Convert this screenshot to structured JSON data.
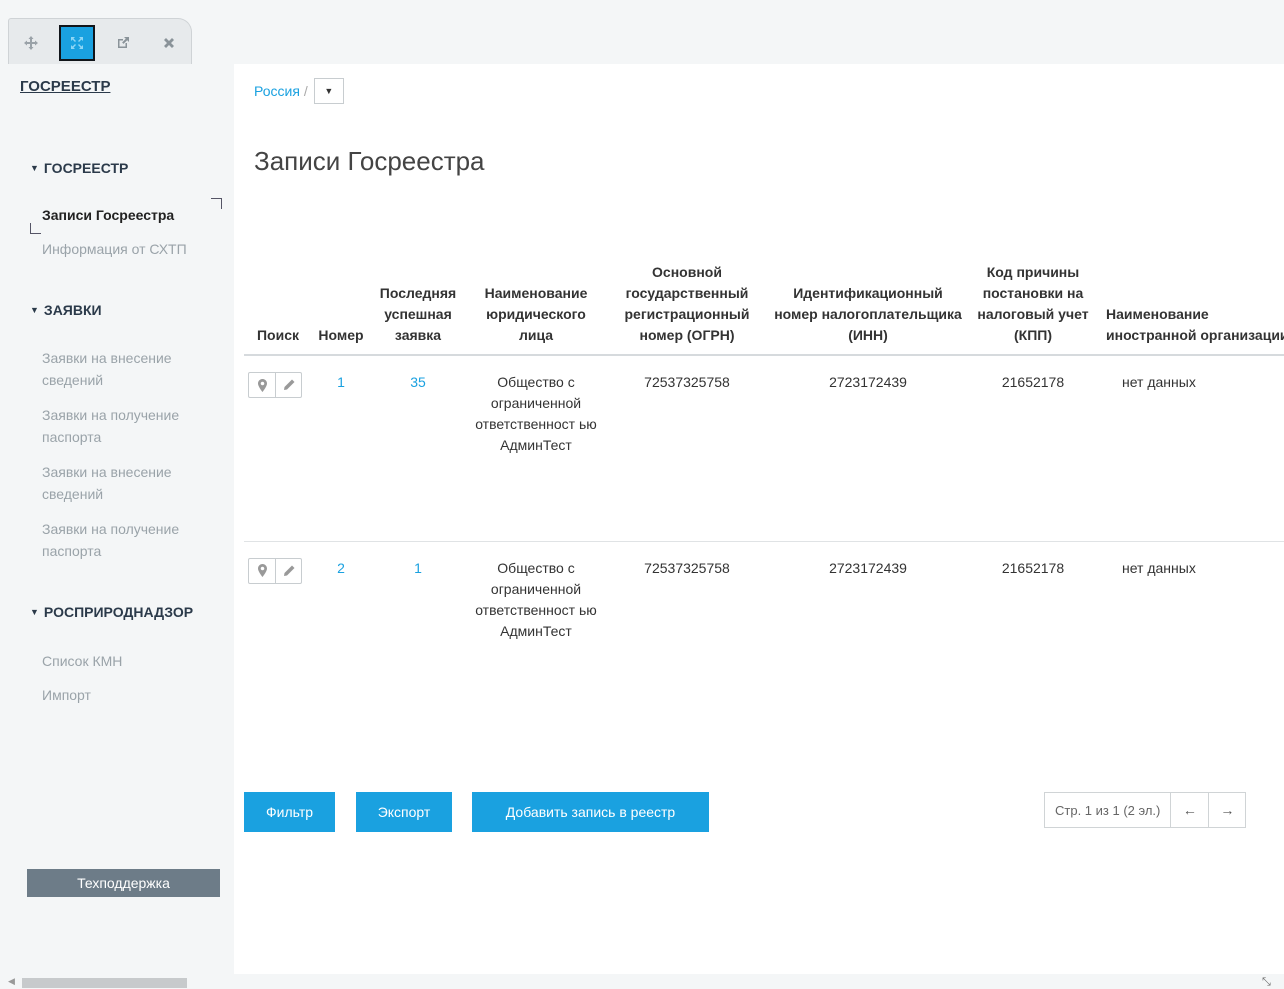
{
  "toolbar": {
    "buttons": [
      {
        "icon": "move-icon"
      },
      {
        "icon": "expand-icon",
        "active": true
      },
      {
        "icon": "external-link-icon"
      },
      {
        "icon": "close-icon"
      }
    ]
  },
  "sidebar": {
    "brand": "ГОСРЕЕСТР",
    "sections": [
      {
        "title": "ГОСРЕЕСТР",
        "items": [
          "Записи Госреестра",
          "Информация от СХТП"
        ]
      },
      {
        "title": "ЗАЯВКИ",
        "items": [
          "Заявки на внесение сведений",
          "Заявки на получение паспорта",
          "Заявки на внесение сведений",
          "Заявки на получение паспорта"
        ]
      },
      {
        "title": "РОСПРИРОДНАДЗОР",
        "items": [
          "Список КМН",
          "Импорт"
        ]
      }
    ],
    "support_label": "Техподдержка"
  },
  "breadcrumb": {
    "root": "Россия",
    "separator": "/"
  },
  "page": {
    "title": "Записи Госреестра"
  },
  "table": {
    "columns": [
      "Поиск",
      "Номер",
      "Последняя успешная заявка",
      "Наименование юридического лица",
      "Основной государственный регистрационный номер (ОГРН)",
      "Идентификационный номер налогоплательщика (ИНН)",
      "Код причины постановки на налоговый учет (КПП)",
      "Наименование иностранной организации"
    ],
    "rows": [
      {
        "number": "1",
        "last_request": "35",
        "name": "Общество с ограниченной ответственност ью АдминТест",
        "ogrn": "72537325758",
        "inn": "2723172439",
        "kpp": "21652178",
        "foreign_name": "нет данных"
      },
      {
        "number": "2",
        "last_request": "1",
        "name": "Общество с ограниченной ответственност ью АдминТест",
        "ogrn": "72537325758",
        "inn": "2723172439",
        "kpp": "21652178",
        "foreign_name": "нет данных"
      }
    ]
  },
  "actions": {
    "filter": "Фильтр",
    "export": "Экспорт",
    "add": "Добавить запись в реестр"
  },
  "pager": {
    "info": "Стр. 1 из 1 (2 эл.)",
    "prev": "←",
    "next": "→"
  },
  "colors": {
    "accent": "#1aa1e0",
    "support_bg": "#6d7c88"
  }
}
